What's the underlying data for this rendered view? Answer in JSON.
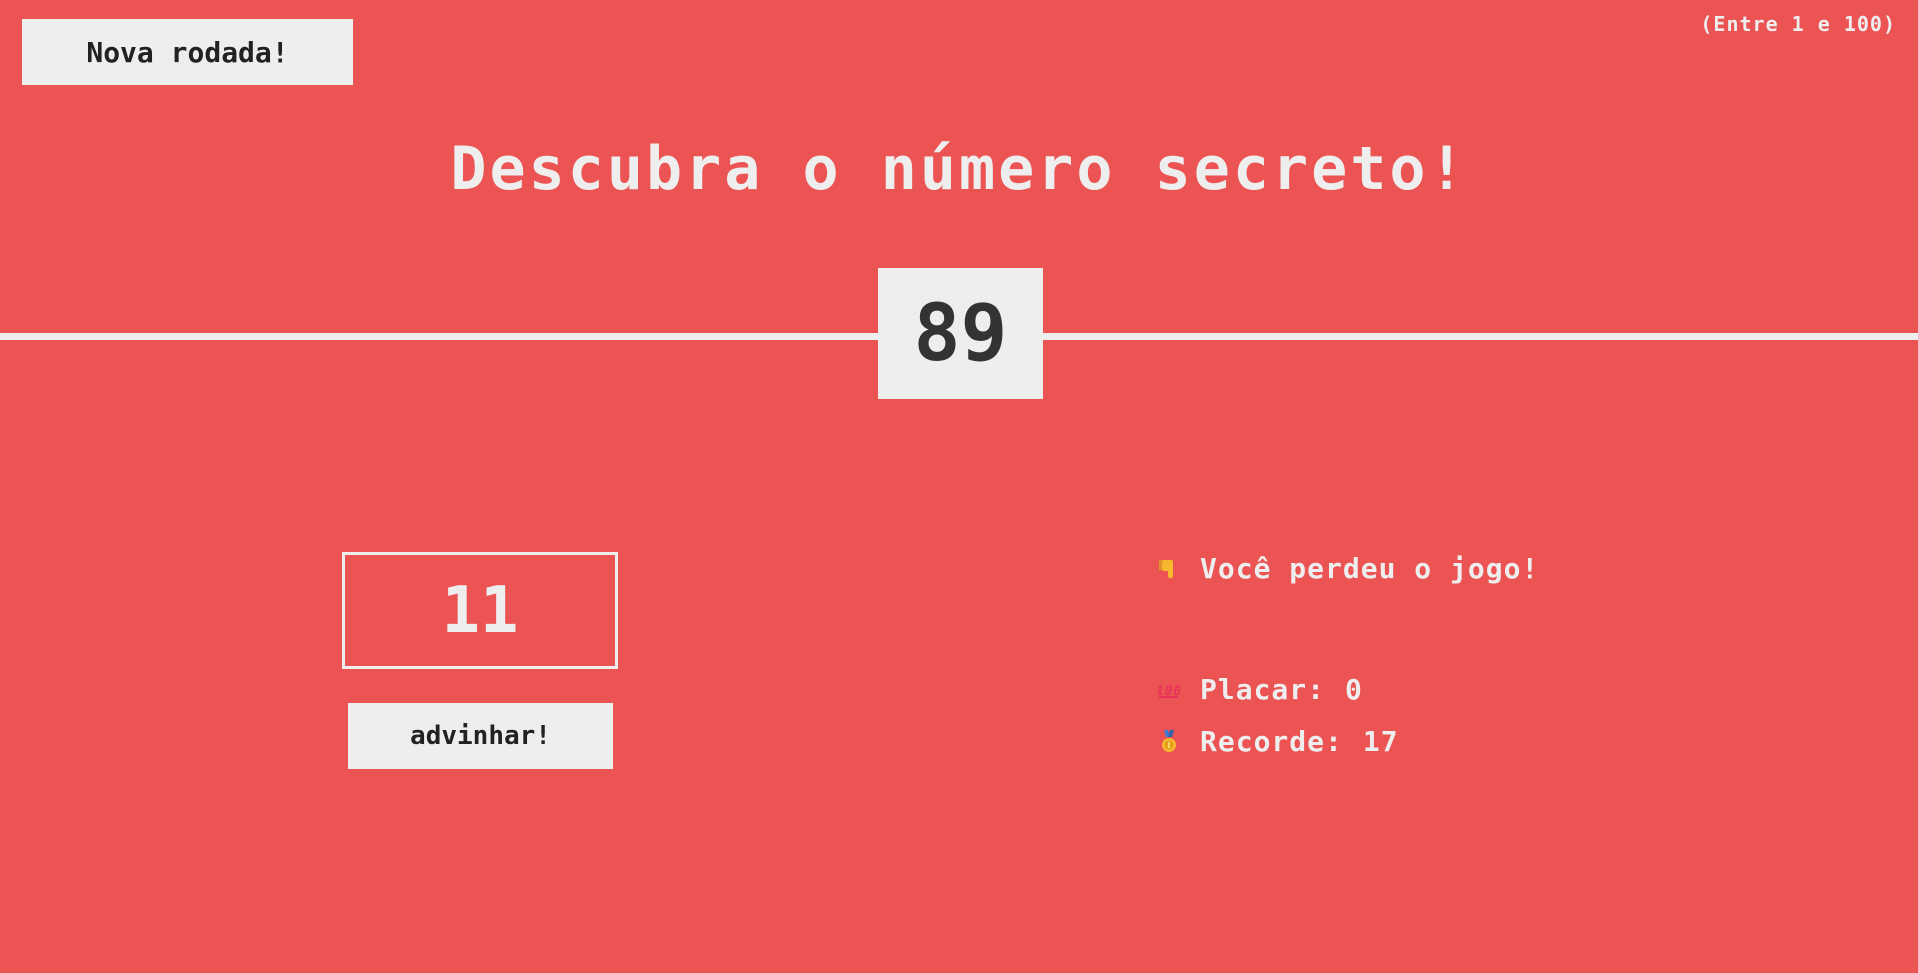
{
  "header": {
    "again_label": "Nova rodada!",
    "between_hint": "(Entre 1 e 100)"
  },
  "title": "Descubra o número secreto!",
  "secret_number": "89",
  "guess": {
    "value": "11"
  },
  "check_label": "advinhar!",
  "status": {
    "message": "Você perdeu o jogo!",
    "message_icon": "thumbs-down-icon",
    "score_label": "Placar:",
    "score_value": "0",
    "score_icon": "hundred-points-icon",
    "highscore_label": "Recorde:",
    "highscore_value": "17",
    "highscore_icon": "medal-icon"
  },
  "colors": {
    "background": "#ec5353",
    "light": "#eeeeee",
    "dark": "#333333"
  }
}
